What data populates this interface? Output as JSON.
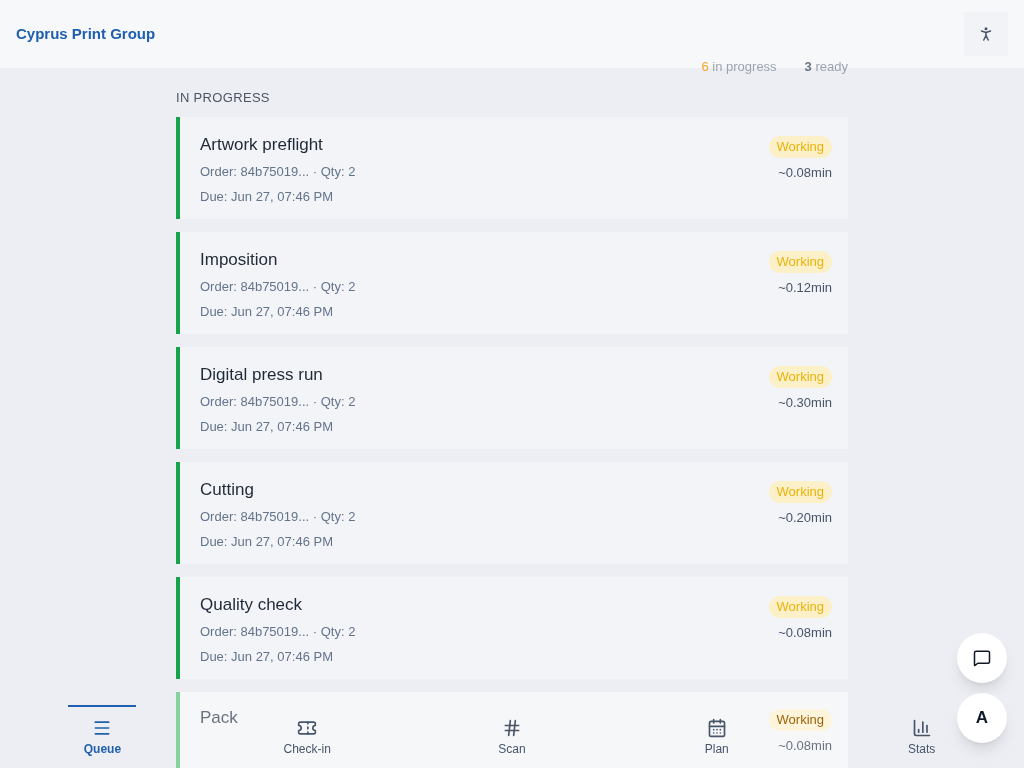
{
  "header": {
    "title": "Cyprus Print Group"
  },
  "summary": {
    "in_progress_count": "6",
    "in_progress_label": "in progress",
    "ready_count": "3",
    "ready_label": "ready"
  },
  "section": {
    "title": "IN PROGRESS"
  },
  "jobs": [
    {
      "title": "Artwork preflight",
      "order": "Order: 84b75019... · Qty: 2",
      "due": "Due: Jun 27, 07:46 PM",
      "status": "Working",
      "estimate": "~0.08min",
      "dimmed": false
    },
    {
      "title": "Imposition",
      "order": "Order: 84b75019... · Qty: 2",
      "due": "Due: Jun 27, 07:46 PM",
      "status": "Working",
      "estimate": "~0.12min",
      "dimmed": false
    },
    {
      "title": "Digital press run",
      "order": "Order: 84b75019... · Qty: 2",
      "due": "Due: Jun 27, 07:46 PM",
      "status": "Working",
      "estimate": "~0.30min",
      "dimmed": false
    },
    {
      "title": "Cutting",
      "order": "Order: 84b75019... · Qty: 2",
      "due": "Due: Jun 27, 07:46 PM",
      "status": "Working",
      "estimate": "~0.20min",
      "dimmed": false
    },
    {
      "title": "Quality check",
      "order": "Order: 84b75019... · Qty: 2",
      "due": "Due: Jun 27, 07:46 PM",
      "status": "Working",
      "estimate": "~0.08min",
      "dimmed": false
    },
    {
      "title": "Pack",
      "status": "Working",
      "estimate": "~0.08min",
      "dimmed": true
    }
  ],
  "nav": [
    {
      "kind": "queue",
      "label": "Queue",
      "selected": true
    },
    {
      "kind": "checkin",
      "label": "Check-in",
      "selected": false
    },
    {
      "kind": "scan",
      "label": "Scan",
      "selected": false
    },
    {
      "kind": "plan",
      "label": "Plan",
      "selected": false
    },
    {
      "kind": "stats",
      "label": "Stats",
      "selected": false
    }
  ],
  "fab": {
    "letter": "A"
  }
}
